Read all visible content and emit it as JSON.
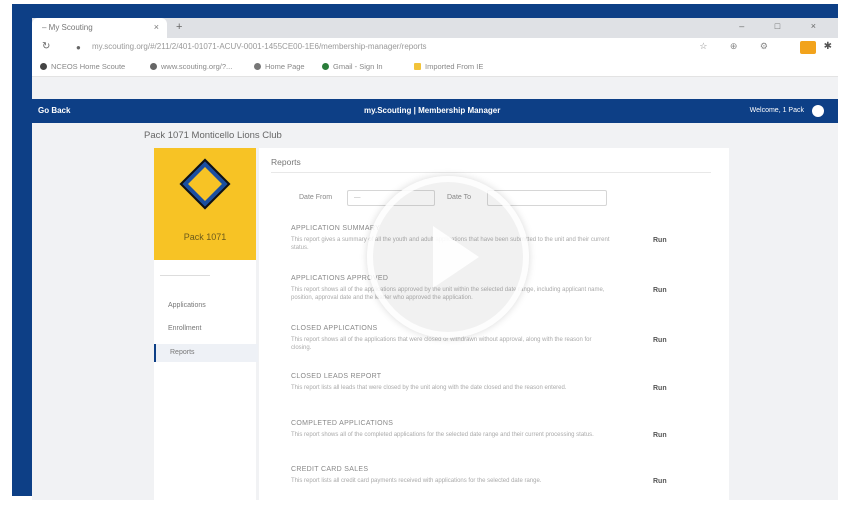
{
  "browser": {
    "tab_title": "– My Scouting",
    "tab_close": "×",
    "new_tab": "+",
    "window_controls": "– □ ×",
    "address_icons": "☆ ⊕ ⚙",
    "extension_icon": "✱",
    "bookmarks": [
      {
        "label": "NCEOS Home Scoute"
      },
      {
        "label": "www.scouting.org/?..."
      },
      {
        "label": "Home Page"
      },
      {
        "label": "Gmail - Sign In"
      },
      {
        "label": "Imported From IE"
      }
    ]
  },
  "app": {
    "go_back": "Go Back",
    "brand": "my.Scouting | Membership Manager",
    "welcome": "Welcome, 1 Pack"
  },
  "page": {
    "title": "Pack 1071 Monticello Lions Club"
  },
  "sidebar": {
    "pack_label": "Pack 1071",
    "items": [
      {
        "label": "Applications"
      },
      {
        "label": "Enrollment"
      },
      {
        "label": "Reports"
      }
    ]
  },
  "reports": {
    "title": "Reports",
    "filters": {
      "date_from_label": "Date From",
      "date_to_label": "Date To"
    },
    "run_label": "Run",
    "items": [
      {
        "title": "APPLICATION SUMMARY",
        "desc": "This report gives a summary of all the youth and adult applications that have been submitted to the unit and their current status."
      },
      {
        "title": "APPLICATIONS APPROVED",
        "desc": "This report shows all of the applications approved by the unit within the selected date range, including applicant name, position, approval date and the leader who approved the application."
      },
      {
        "title": "CLOSED APPLICATIONS",
        "desc": "This report shows all of the applications that were closed or withdrawn without approval, along with the reason for closing."
      },
      {
        "title": "CLOSED LEADS REPORT",
        "desc": "This report lists all leads that were closed by the unit along with the date closed and the reason entered."
      },
      {
        "title": "COMPLETED APPLICATIONS",
        "desc": "This report shows all of the completed applications for the selected date range and their current processing status."
      },
      {
        "title": "CREDIT CARD SALES",
        "desc": "This report lists all credit card payments received with applications for the selected date range."
      }
    ]
  }
}
